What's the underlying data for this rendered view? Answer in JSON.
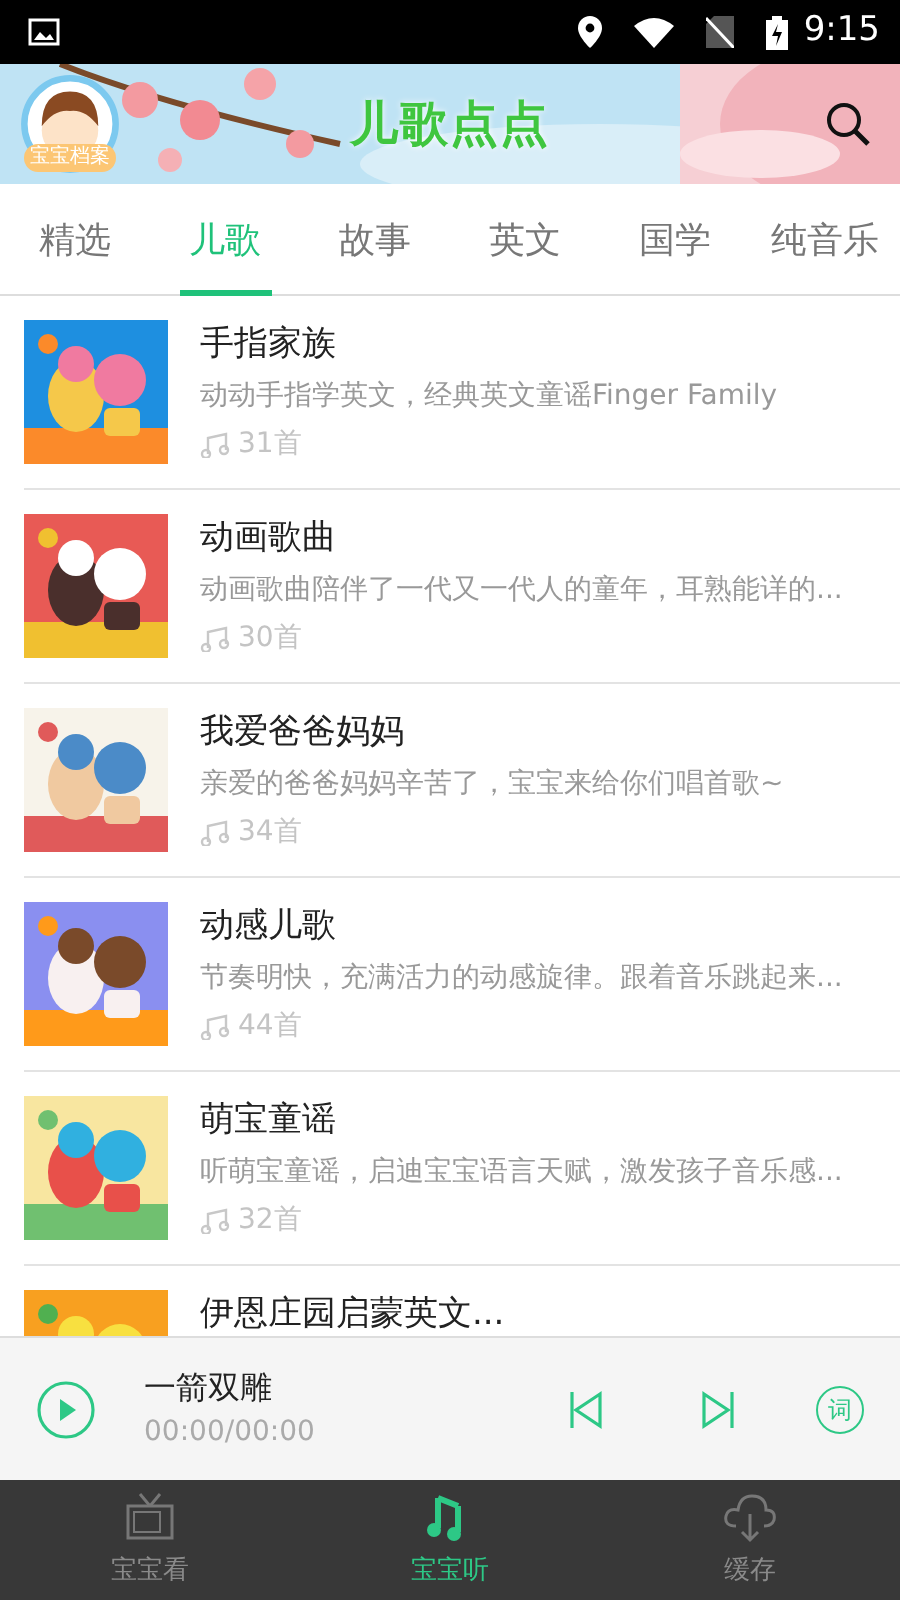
{
  "status_bar": {
    "time": "9:15"
  },
  "header": {
    "profile_label": "宝宝档案",
    "logo": "儿歌点点"
  },
  "tabs": [
    {
      "label": "精选",
      "selected": false
    },
    {
      "label": "儿歌",
      "selected": true
    },
    {
      "label": "故事",
      "selected": false
    },
    {
      "label": "英文",
      "selected": false
    },
    {
      "label": "国学",
      "selected": false
    },
    {
      "label": "纯音乐",
      "selected": false
    }
  ],
  "albums": [
    {
      "title": "手指家族",
      "description": "动动手指学英文，经典英文童谣Finger Family",
      "count": "31首"
    },
    {
      "title": "动画歌曲",
      "description": "动画歌曲陪伴了一代又一代人的童年，耳熟能详的...",
      "count": "30首"
    },
    {
      "title": "我爱爸爸妈妈",
      "description": "亲爱的爸爸妈妈辛苦了，宝宝来给你们唱首歌~",
      "count": "34首"
    },
    {
      "title": "动感儿歌",
      "description": "节奏明快，充满活力的动感旋律。跟着音乐跳起来...",
      "count": "44首"
    },
    {
      "title": "萌宝童谣",
      "description": "听萌宝童谣，启迪宝宝语言天赋，激发孩子音乐感...",
      "count": "32首"
    },
    {
      "title": "伊恩庄园启蒙英文..."
    }
  ],
  "player": {
    "title": "一箭双雕",
    "time": "00:00/00:00",
    "lyrics_label": "词"
  },
  "bottom_nav": [
    {
      "label": "宝宝看",
      "kind": "tv",
      "selected": false
    },
    {
      "label": "宝宝听",
      "kind": "music",
      "selected": true
    },
    {
      "label": "缓存",
      "kind": "download",
      "selected": false
    }
  ]
}
